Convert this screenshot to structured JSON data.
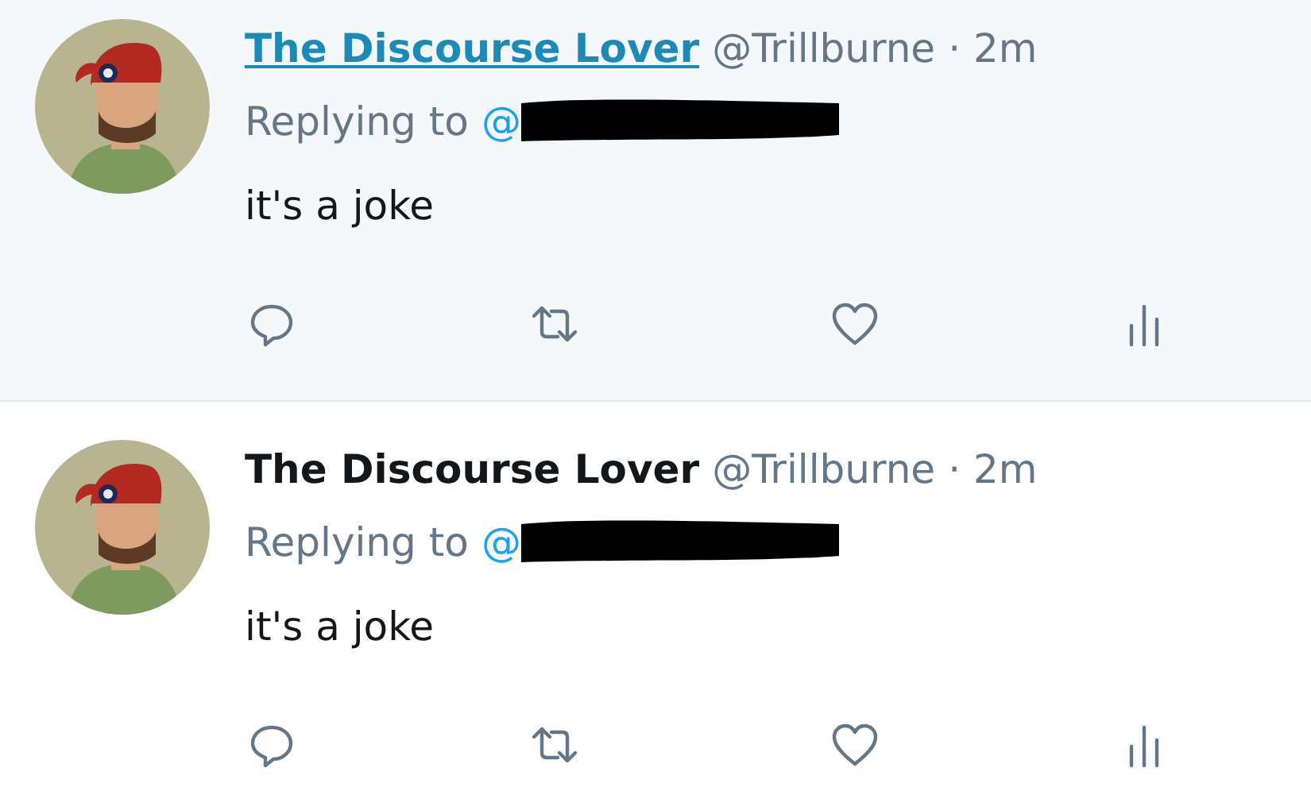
{
  "tweets": [
    {
      "hovered": true,
      "author": "The Discourse Lover",
      "handle": "@Trillburne",
      "separator": "·",
      "time": "2m",
      "replying_label": "Replying to",
      "reply_handle": "@",
      "text": "it's a joke"
    },
    {
      "hovered": false,
      "author": "The Discourse Lover",
      "handle": "@Trillburne",
      "separator": "·",
      "time": "2m",
      "replying_label": "Replying to",
      "reply_handle": "@",
      "text": "it's a joke"
    }
  ]
}
